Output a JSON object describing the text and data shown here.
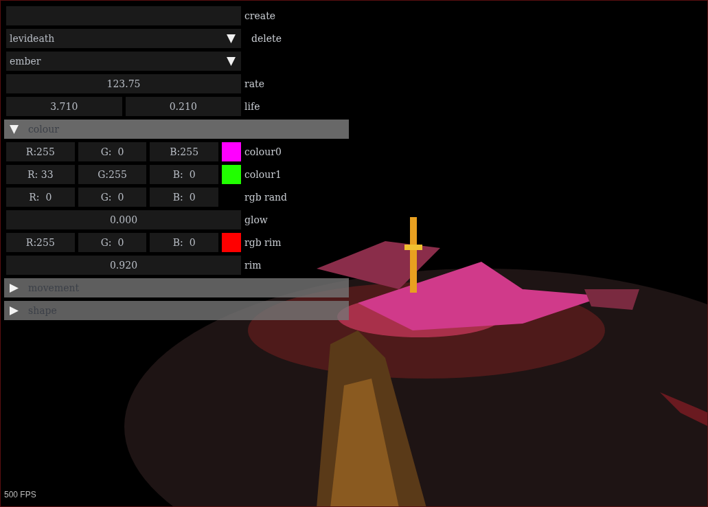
{
  "rows": [
    {
      "kind": "input",
      "label": "create"
    },
    {
      "kind": "combo",
      "value": "levideath",
      "label": "delete"
    },
    {
      "kind": "combo",
      "value": "ember"
    },
    {
      "kind": "drag",
      "values": [
        "123.75"
      ],
      "label": "rate"
    },
    {
      "kind": "drag",
      "values": [
        "3.710",
        "0.210"
      ],
      "label": "life"
    },
    {
      "kind": "header",
      "label": "colour",
      "expanded": true
    },
    {
      "kind": "rgb",
      "values": [
        "R:255",
        "G:  0",
        "B:255"
      ],
      "color": "#ff00ff",
      "label": "colour0"
    },
    {
      "kind": "rgb",
      "values": [
        "R: 33",
        "G:255",
        "B:  0"
      ],
      "color": "#21ff00",
      "label": "colour1"
    },
    {
      "kind": "rgb",
      "values": [
        "R:  0",
        "G:  0",
        "B:  0"
      ],
      "label": "rgb rand"
    },
    {
      "kind": "drag",
      "values": [
        "0.000"
      ],
      "label": "glow"
    },
    {
      "kind": "rgb",
      "values": [
        "R:255",
        "G:  0",
        "B:  0"
      ],
      "color": "#ff0000",
      "label": "rgb rim"
    },
    {
      "kind": "drag",
      "values": [
        "0.920"
      ],
      "label": "rim"
    },
    {
      "kind": "header",
      "label": "movement",
      "expanded": false
    },
    {
      "kind": "header",
      "label": "shape",
      "expanded": false
    }
  ],
  "fps": "500 FPS"
}
